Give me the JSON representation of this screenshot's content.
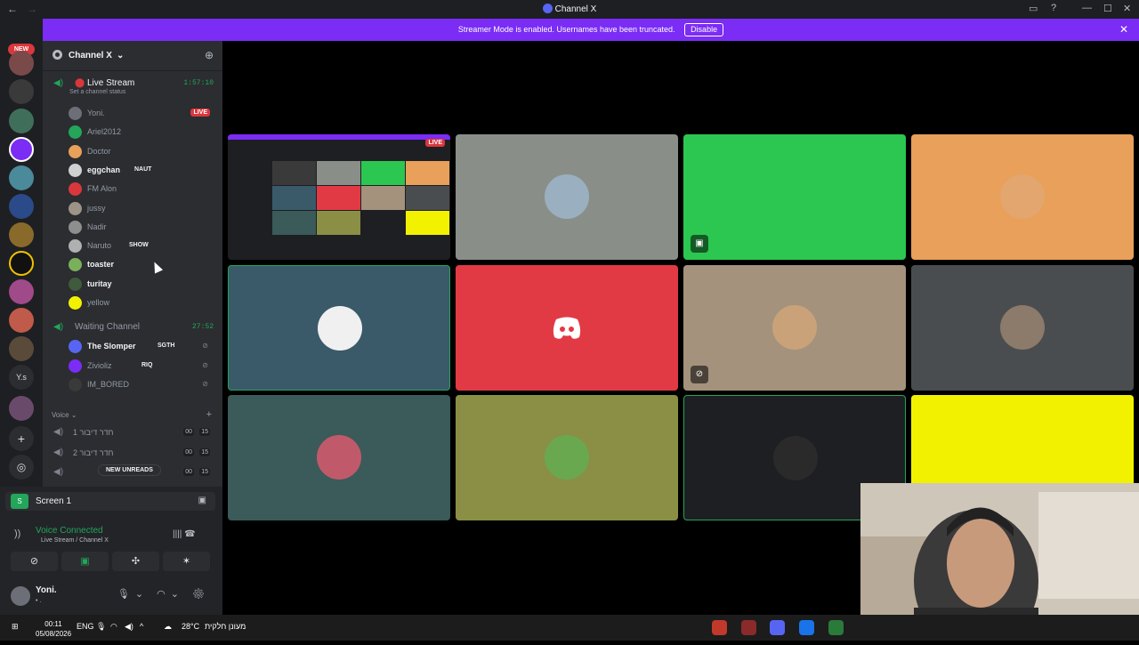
{
  "titlebar": {
    "title": "Channel X",
    "back_icon": "←",
    "forward_icon": "→"
  },
  "banner": {
    "text": "Streamer Mode is enabled. Usernames have been truncated.",
    "disable_label": "Disable"
  },
  "servers": {
    "new_badge": "NEW",
    "ys_label": "Y.s"
  },
  "channel_header": {
    "name": "Channel X"
  },
  "live_channel": {
    "name": "Live Stream",
    "elapsed": "1:57:10",
    "status_hint": "Set a channel status",
    "live_badge": "LIVE",
    "users": [
      {
        "name": "Yoni.",
        "bold": false,
        "color": "#6d6f78",
        "tag": "",
        "live": true
      },
      {
        "name": "Ariel2012",
        "bold": false,
        "color": "#23a55a",
        "tag": ""
      },
      {
        "name": "Doctor",
        "bold": false,
        "color": "#e8a05a",
        "tag": ""
      },
      {
        "name": "eggchan",
        "bold": true,
        "color": "#d0d0d0",
        "tag": "NAUT"
      },
      {
        "name": "FM Alon",
        "bold": false,
        "color": "#da373c",
        "tag": ""
      },
      {
        "name": "jussy",
        "bold": false,
        "color": "#9c9486",
        "tag": ""
      },
      {
        "name": "Nadir",
        "bold": false,
        "color": "#8e8e8e",
        "tag": ""
      },
      {
        "name": "Naruto",
        "bold": false,
        "color": "#b0b0b0",
        "tag": "SHOW"
      },
      {
        "name": "toaster",
        "bold": true,
        "color": "#7ab05a",
        "tag": ""
      },
      {
        "name": "turitay",
        "bold": true,
        "color": "#3f5a3c",
        "tag": ""
      },
      {
        "name": "yellow",
        "bold": false,
        "color": "#f2f200",
        "tag": ""
      }
    ]
  },
  "waiting_channel": {
    "name": "Waiting Channel",
    "elapsed": "27:52",
    "users": [
      {
        "name": "The Slomper",
        "bold": true,
        "color": "#5865f2",
        "tag": "SGTH"
      },
      {
        "name": "Zivioliz",
        "bold": false,
        "color": "#7b2cf5",
        "tag": "RIQ"
      },
      {
        "name": "IM_BORED",
        "bold": false,
        "color": "#3a3a3a",
        "tag": ""
      }
    ]
  },
  "voice_category": {
    "label": "Voice",
    "channels": [
      {
        "name": "חדר דיבור 1",
        "count": "15",
        "in": "00"
      },
      {
        "name": "חדר דיבור 2",
        "count": "15",
        "in": "00"
      },
      {
        "name": "",
        "count": "15",
        "in": "00"
      }
    ],
    "new_unreads": "NEW UNREADS"
  },
  "panel": {
    "screen_label": "Screen 1",
    "voice_connected": "Voice Connected",
    "voice_sub": "Live Stream / Channel X",
    "username": "Yoni.",
    "user_status": "• ."
  },
  "grid": {
    "live_badge": "LIVE",
    "tiles": [
      {
        "bg": "#1e1f22",
        "stream": true
      },
      {
        "bg": "#8a8e89",
        "avatar": "#9ab0c0"
      },
      {
        "bg": "#2cc750",
        "badge": "screen-share-icon"
      },
      {
        "bg": "#e8a05a",
        "avatar": "#e2a66e"
      },
      {
        "bg": "#3a5a6a",
        "avatar": "#f0f0f0",
        "selected": true
      },
      {
        "bg": "#e23a45",
        "discord": true
      },
      {
        "bg": "#a4927c",
        "avatar": "#c9a27a",
        "badge": "muted-icon"
      },
      {
        "bg": "#4a4d50",
        "avatar": "#8c7a6a"
      },
      {
        "bg": "#3b5a5a",
        "avatar": "#c05a6a"
      },
      {
        "bg": "#8a8f45",
        "avatar": "#6aa84f"
      },
      {
        "bg": "#1e1f22",
        "avatar": "#2a2a2a",
        "selected": true
      },
      {
        "bg": "#f2f200"
      }
    ]
  },
  "taskbar": {
    "time": "00:11",
    "date": "05/08/2026",
    "lang": "ENG",
    "weather_temp": "28°C",
    "weather_text": "מעונן חלקית"
  }
}
